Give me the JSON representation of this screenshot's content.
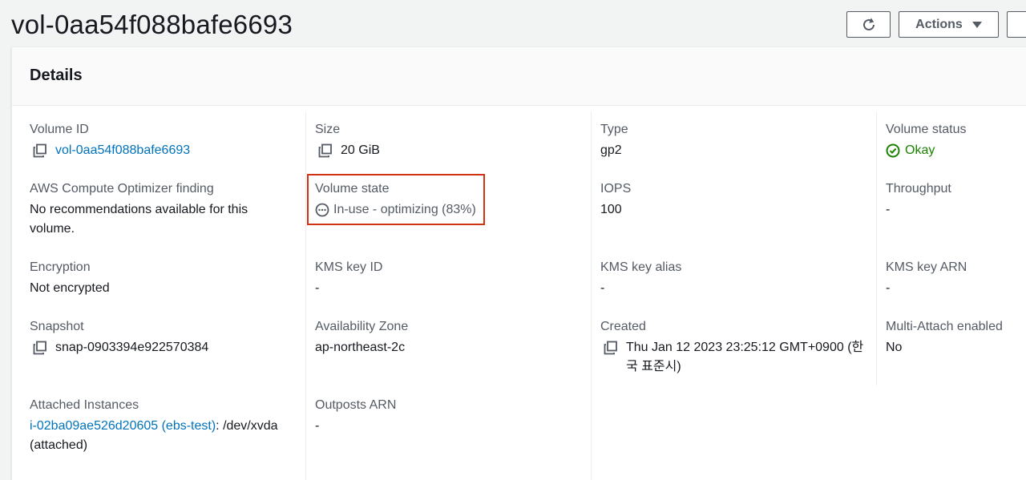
{
  "header": {
    "title": "vol-0aa54f088bafe6693",
    "actions_label": "Actions"
  },
  "panel": {
    "title": "Details"
  },
  "fields": {
    "volume_id": {
      "label": "Volume ID",
      "value": "vol-0aa54f088bafe6693"
    },
    "size": {
      "label": "Size",
      "value": "20 GiB"
    },
    "type": {
      "label": "Type",
      "value": "gp2"
    },
    "volume_status": {
      "label": "Volume status",
      "value": "Okay"
    },
    "optimizer": {
      "label": "AWS Compute Optimizer finding",
      "value": "No recommendations available for this volume."
    },
    "volume_state": {
      "label": "Volume state",
      "value": "In-use - optimizing (83%)"
    },
    "iops": {
      "label": "IOPS",
      "value": "100"
    },
    "throughput": {
      "label": "Throughput",
      "value": "-"
    },
    "encryption": {
      "label": "Encryption",
      "value": "Not encrypted"
    },
    "kms_key_id": {
      "label": "KMS key ID",
      "value": "-"
    },
    "kms_key_alias": {
      "label": "KMS key alias",
      "value": "-"
    },
    "kms_key_arn": {
      "label": "KMS key ARN",
      "value": "-"
    },
    "snapshot": {
      "label": "Snapshot",
      "value": "snap-0903394e922570384"
    },
    "availability_zone": {
      "label": "Availability Zone",
      "value": "ap-northeast-2c"
    },
    "created": {
      "label": "Created",
      "value": "Thu Jan 12 2023 23:25:12 GMT+0900 (한국 표준시)"
    },
    "multi_attach": {
      "label": "Multi-Attach enabled",
      "value": "No"
    },
    "attached_instances": {
      "label": "Attached Instances",
      "link": "i-02ba09ae526d20605 (ebs-test)",
      "suffix": ": /dev/xvda (attached)"
    },
    "outposts_arn": {
      "label": "Outposts ARN",
      "value": "-"
    }
  },
  "icons": {
    "copy": "copy-icon",
    "refresh": "refresh-icon",
    "status_ok": "check-circle-icon",
    "status_pending": "ellipsis-circle-icon"
  },
  "colors": {
    "link": "#0073bb",
    "success": "#1d8102",
    "highlight": "#d13212"
  }
}
